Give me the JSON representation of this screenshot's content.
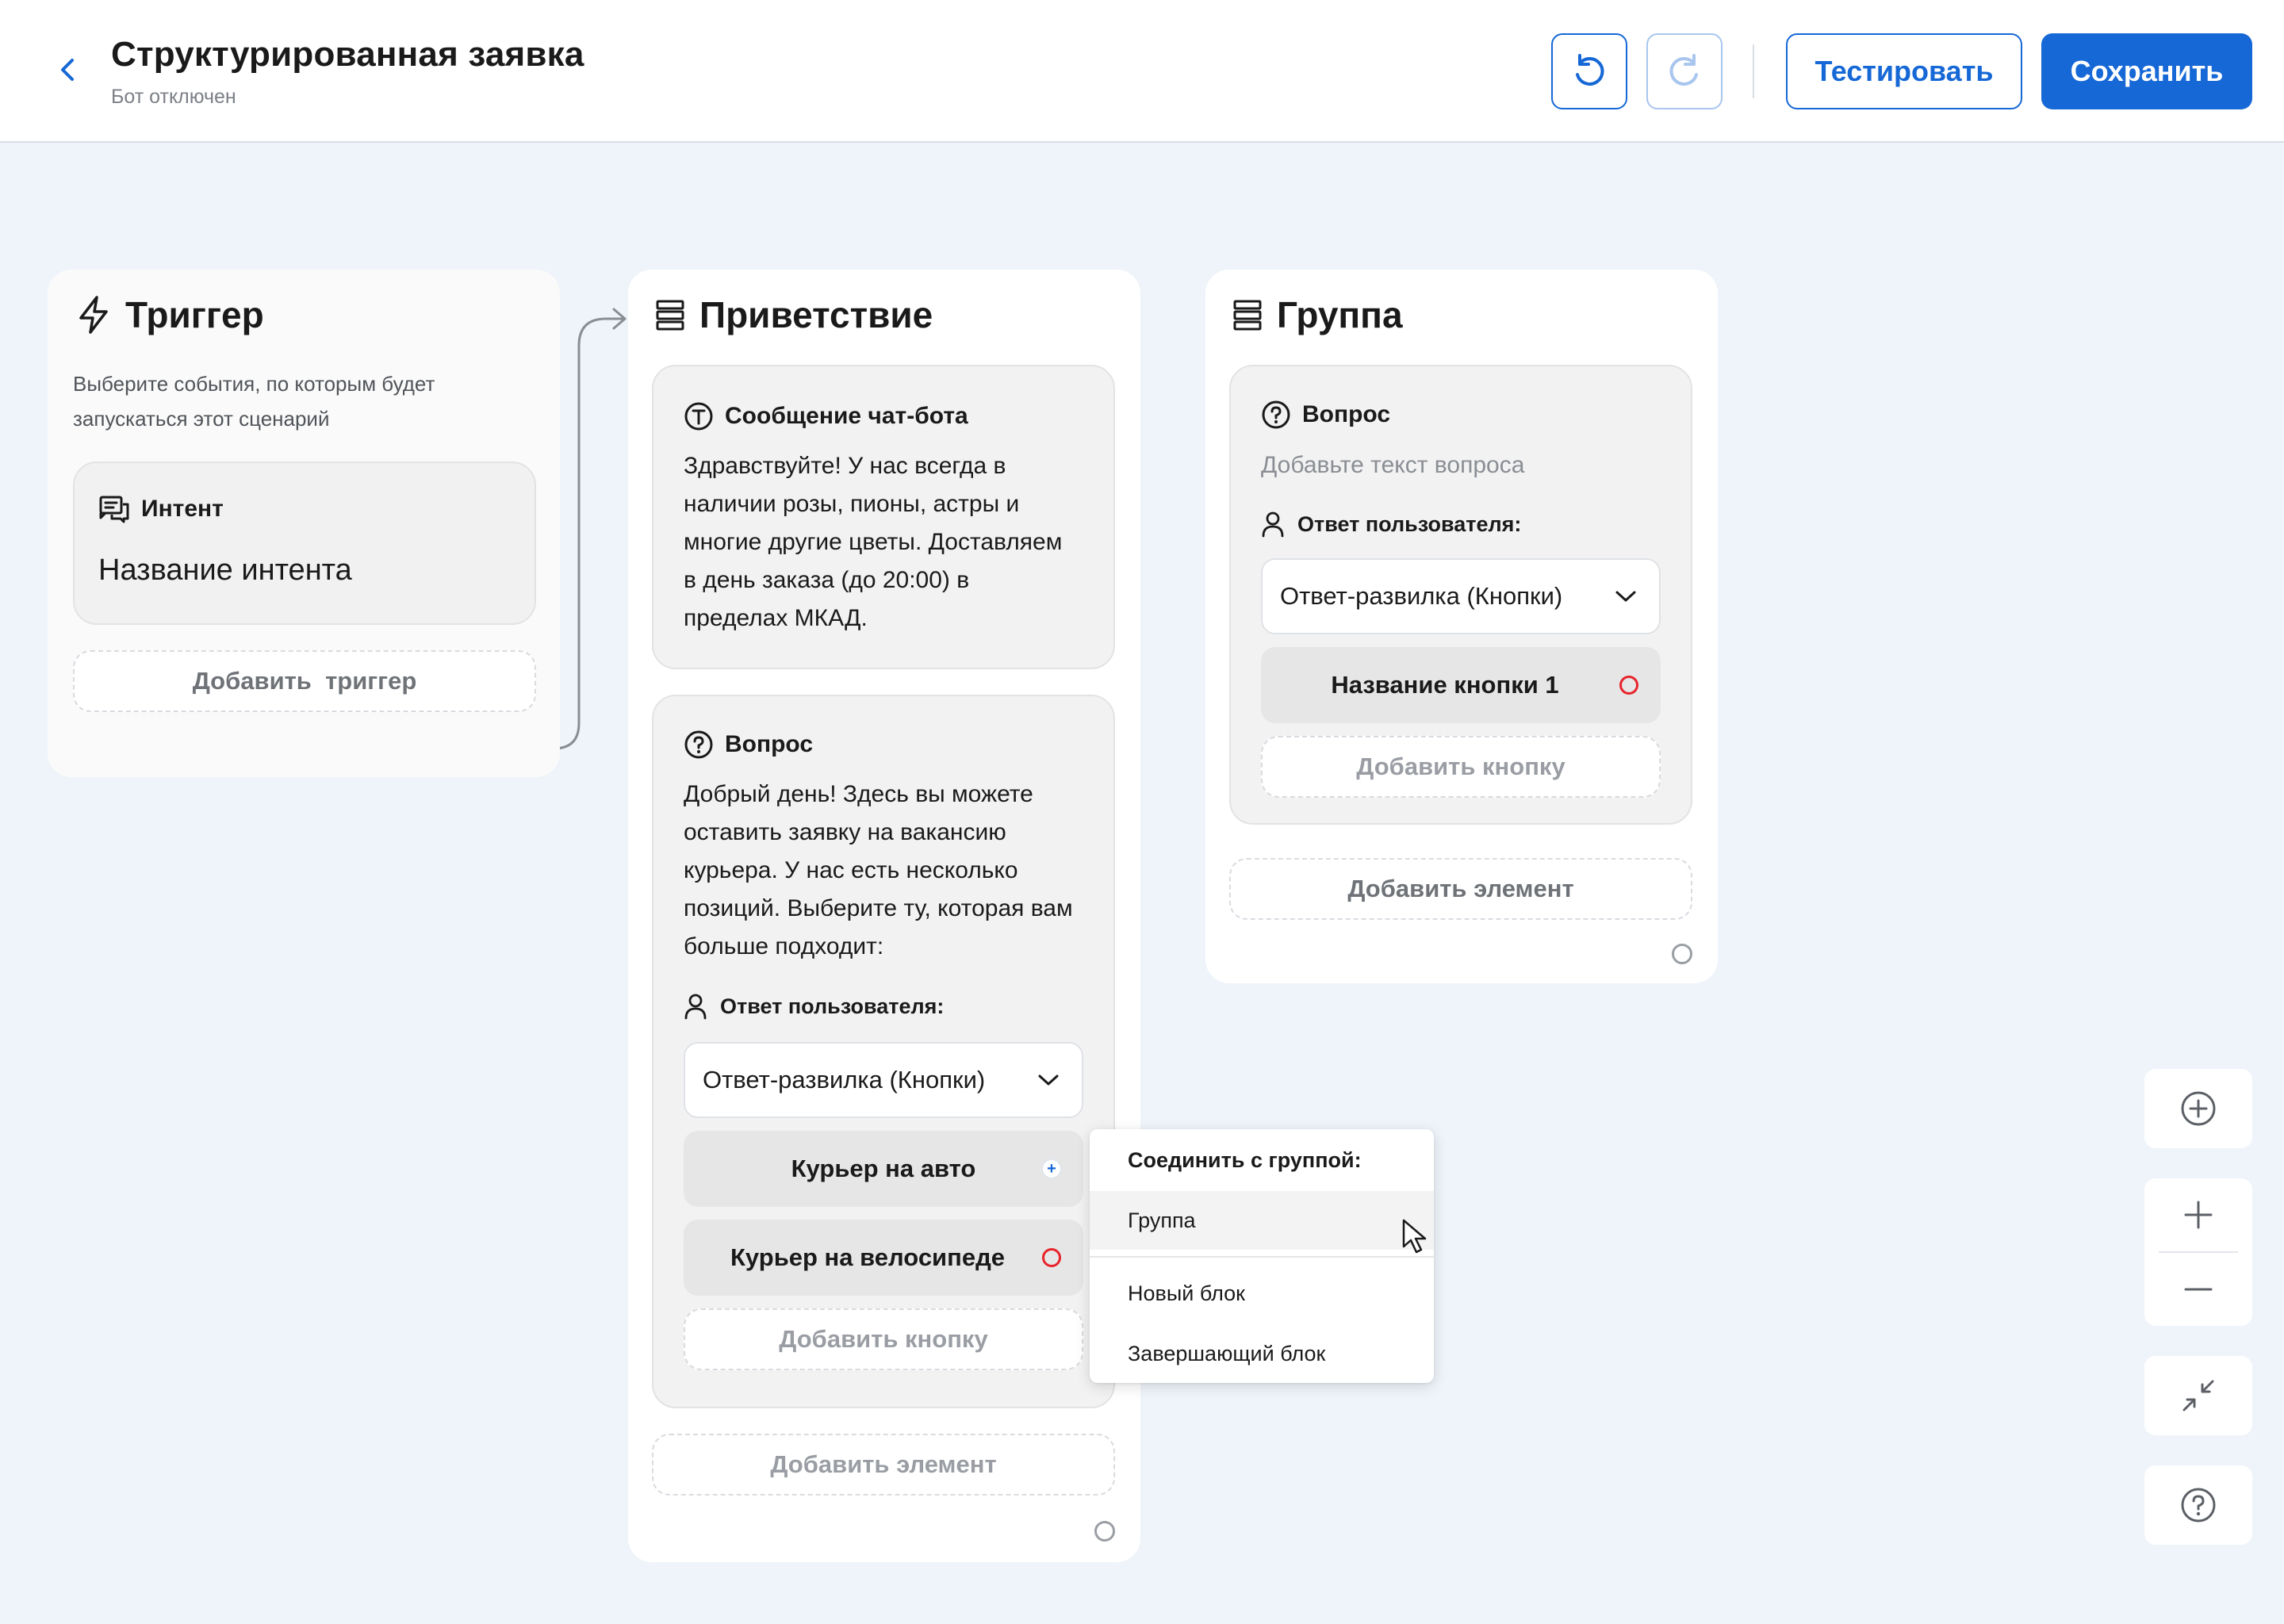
{
  "header": {
    "title": "Структурированная заявка",
    "subtitle": "Бот отключен",
    "test_label": "Тестировать",
    "save_label": "Сохранить"
  },
  "trigger_block": {
    "title": "Триггер",
    "description_line1": "Выберите события, по которым будет",
    "description_line2": "запускаться этот сценарий",
    "intent_label": "Интент",
    "intent_name": "Название интента",
    "add_trigger_label": "Добавить  триггер"
  },
  "greeting_block": {
    "title": "Приветствие",
    "message_card": {
      "label": "Сообщение чат-бота",
      "lines": [
        "Здравствуйте! У нас всегда в",
        "наличии розы, пионы, астры и",
        "многие другие цветы. Доставляем",
        "в день заказа (до 20:00) в",
        "пределах МКАД."
      ]
    },
    "question_card": {
      "label": "Вопрос",
      "lines": [
        "Добрый день! Здесь вы можете",
        "оставить заявку на вакансию",
        "курьера. У нас есть несколько",
        "позиций. Выберите ту, которая вам",
        "больше подходит:"
      ],
      "user_answer_label": "Ответ пользователя:",
      "answer_type": "Ответ-развилка (Кнопки)",
      "buttons": [
        "Курьер на авто",
        "Курьер на велосипеде"
      ],
      "add_button_label": "Добавить кнопку"
    },
    "add_element_label": "Добавить элемент"
  },
  "group_block": {
    "title": "Группа",
    "question_card": {
      "label": "Вопрос",
      "placeholder": "Добавьте текст вопроса",
      "user_answer_label": "Ответ пользователя:",
      "answer_type": "Ответ-развилка (Кнопки)",
      "buttons": [
        "Название кнопки 1"
      ],
      "add_button_label": "Добавить кнопку"
    },
    "add_element_label": "Добавить элемент"
  },
  "connect_menu": {
    "header": "Соединить с группой:",
    "items": [
      "Группа",
      "Новый блок",
      "Завершающий блок"
    ]
  },
  "colors": {
    "accent": "#1668d6",
    "canvas": "#eff4fa",
    "port_red": "#e8232b"
  },
  "icons": {
    "back": "chevron-left-icon",
    "undo": "undo-icon",
    "redo": "redo-icon",
    "trigger": "lightning-icon",
    "block": "stack-icon",
    "intent": "chat-icon",
    "message": "text-t-icon",
    "question": "question-circle-icon",
    "user": "user-icon",
    "dropdown": "chevron-down-icon",
    "zoom_fit": "plus-circle-icon",
    "zoom_in": "plus-icon",
    "zoom_out": "minus-icon",
    "collapse": "collapse-arrows-icon",
    "help": "help-circle-icon"
  }
}
